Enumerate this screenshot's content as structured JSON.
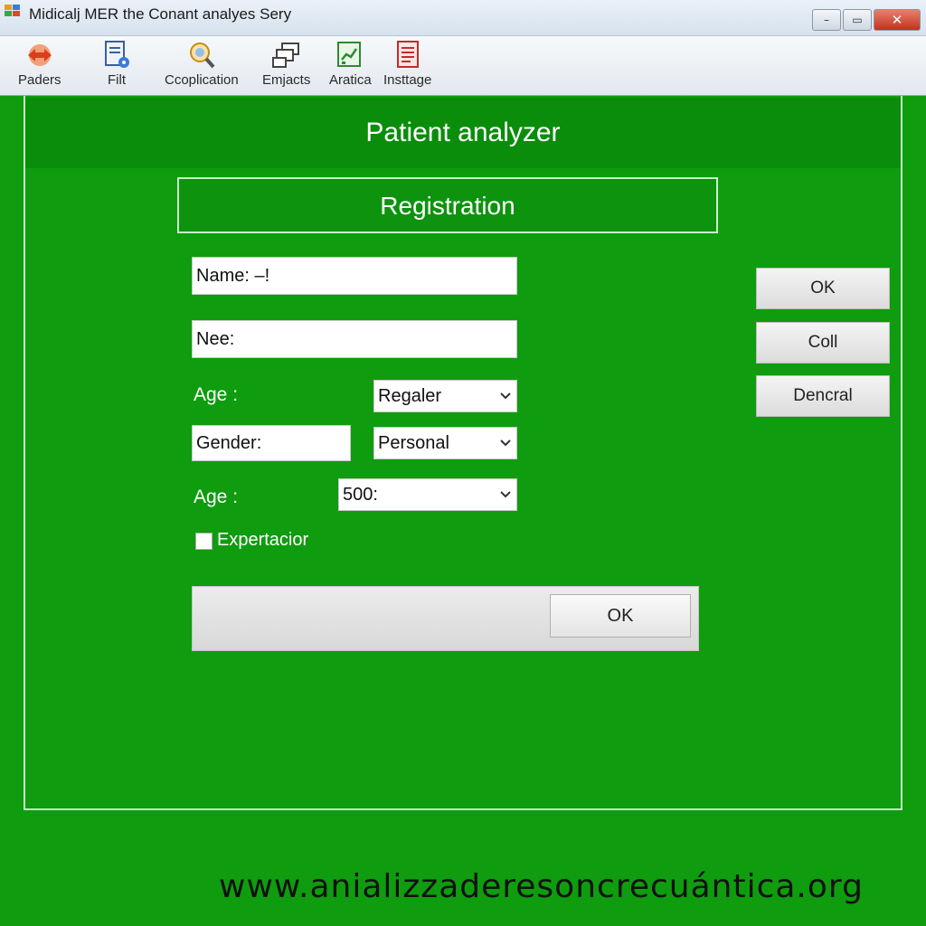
{
  "window": {
    "title": "Midicalj MER the Conant analyes Sery",
    "buttons": {
      "minimize": "–",
      "maximize": "▭",
      "close": "✕"
    }
  },
  "toolbar": {
    "items": [
      {
        "label": "Paders",
        "icon": "arrows-icon"
      },
      {
        "label": "Filt",
        "icon": "document-gear-icon"
      },
      {
        "label": "Ccoplication",
        "icon": "magnifier-icon"
      },
      {
        "label": "Emjacts",
        "icon": "layers-icon"
      },
      {
        "label": "Aratica",
        "icon": "chart-document-icon"
      },
      {
        "label": "Insttage",
        "icon": "form-document-icon"
      }
    ]
  },
  "main": {
    "header_title": "Patient analyzer",
    "section_title": "Registration",
    "fields": {
      "name": "Name: –!",
      "nee": "Nee:",
      "gender": "Gender:"
    },
    "labels": {
      "age1": "Age :",
      "age2": "Age :"
    },
    "selects": {
      "type": "Regaler",
      "category": "Personal",
      "value": "500:"
    },
    "checkbox": {
      "label": "Expertacior",
      "checked": false
    },
    "side_buttons": {
      "ok": "OK",
      "coll": "Coll",
      "dencral": "Dencral"
    },
    "bottom_ok": "OK"
  },
  "watermark": "www.anializzaderesoncrecuántica.org"
}
